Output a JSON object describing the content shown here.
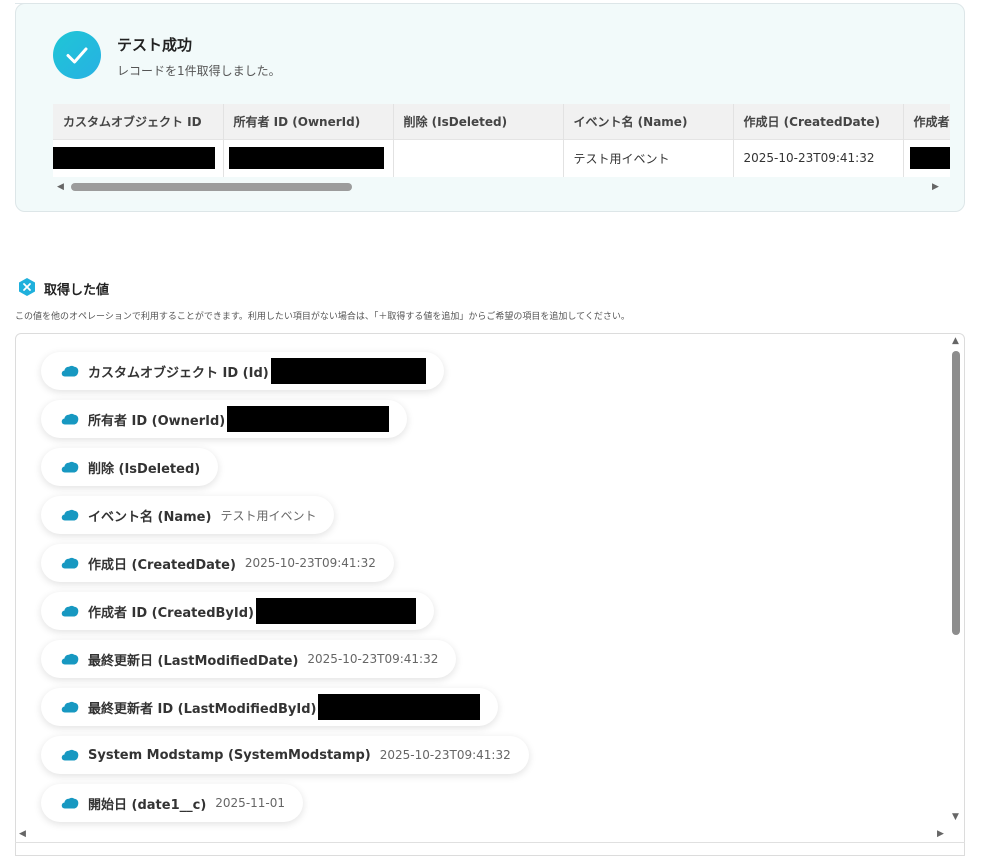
{
  "success": {
    "title": "テスト成功",
    "subtitle": "レコードを1件取得しました。"
  },
  "table": {
    "headers": [
      "カスタムオブジェクト ID",
      "所有者 ID (OwnerId)",
      "削除 (IsDeleted)",
      "イベント名 (Name)",
      "作成日 (CreatedDate)",
      "作成者"
    ],
    "row": [
      "",
      "",
      "",
      "テスト用イベント",
      "2025-10-23T09:41:32",
      ""
    ]
  },
  "captured": {
    "title": "取得した値",
    "description": "この値を他のオペレーションで利用することができます。利用したい項目がない場合は、「＋取得する値を追加」からご希望の項目を追加してください。",
    "items": [
      {
        "label": "カスタムオブジェクト ID (Id)",
        "value": ""
      },
      {
        "label": "所有者 ID (OwnerId)",
        "value": ""
      },
      {
        "label": "削除 (IsDeleted)",
        "value": ""
      },
      {
        "label": "イベント名 (Name)",
        "value": "テスト用イベント"
      },
      {
        "label": "作成日 (CreatedDate)",
        "value": "2025-10-23T09:41:32"
      },
      {
        "label": "作成者 ID (CreatedById)",
        "value": ""
      },
      {
        "label": "最終更新日 (LastModifiedDate)",
        "value": "2025-10-23T09:41:32"
      },
      {
        "label": "最終更新者 ID (LastModifiedById)",
        "value": ""
      },
      {
        "label": "System Modstamp (SystemModstamp)",
        "value": "2025-10-23T09:41:32"
      },
      {
        "label": "開始日 (date1__c)",
        "value": "2025-11-01"
      }
    ]
  },
  "colors": {
    "accent": "#1fc6d6",
    "salesforce": "#1798c1"
  },
  "icons": {
    "success": "check-icon",
    "captured": "x-badge-icon",
    "item": "salesforce-cloud-icon"
  }
}
